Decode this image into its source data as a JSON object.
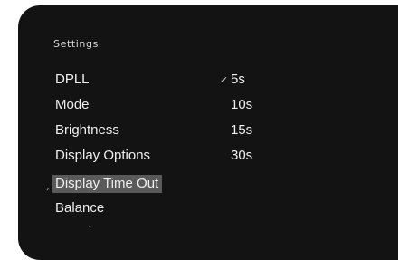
{
  "settings": {
    "title": "Settings",
    "menu": [
      {
        "label": "DPLL"
      },
      {
        "label": "Mode"
      },
      {
        "label": "Brightness"
      },
      {
        "label": "Display Options"
      },
      {
        "label": "Display Time Out"
      },
      {
        "label": "Balance"
      }
    ],
    "selected_index": 4,
    "selection_arrow_icon": "chevron-right-icon",
    "scroll_icon": "chevron-down-icon",
    "options": [
      {
        "label": "5s",
        "checked": true
      },
      {
        "label": "10s",
        "checked": false
      },
      {
        "label": "15s",
        "checked": false
      },
      {
        "label": "30s",
        "checked": false
      }
    ],
    "check_glyph": "✓",
    "arrow_glyph": "›",
    "scroll_glyph": "⌄",
    "colors": {
      "panel_bg": "#131313",
      "highlight_bg": "#5a5a5a",
      "text": "#efefef"
    }
  }
}
